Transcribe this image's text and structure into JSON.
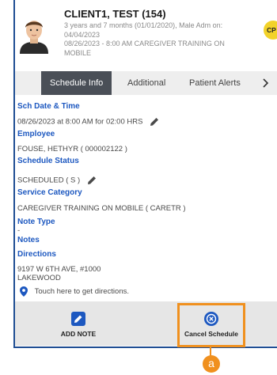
{
  "client": {
    "name": "CLIENT1, TEST (154)",
    "details_line1": "3 years and 7 months (01/01/2020), Male Adm on:",
    "details_line2": "04/04/2023",
    "details_line3": "08/26/2023 - 8:00 AM CAREGIVER TRAINING ON",
    "details_line4": "MOBILE",
    "badge": "CP"
  },
  "tabs": [
    {
      "label": "Schedule Info",
      "active": true
    },
    {
      "label": "Additional",
      "active": false
    },
    {
      "label": "Patient Alerts",
      "active": false
    }
  ],
  "tabs_more_icon": "chevron-right-icon",
  "fields": {
    "sch_date_label": "Sch Date & Time",
    "sch_date_value": "08/26/2023 at 8:00 AM for 02:00 HRS",
    "employee_label": "Employee",
    "employee_value": "FOUSE, HETHYR ( 000002122 )",
    "status_label": "Schedule Status",
    "status_value": "SCHEDULED ( S )",
    "service_label": "Service Category",
    "service_value": "CAREGIVER TRAINING ON MOBILE ( CARETR )",
    "note_type_label": "Note Type",
    "note_type_value": "-",
    "notes_label": "Notes",
    "directions_label": "Directions",
    "address_line1": "9197 W 6TH AVE, #1000",
    "address_line2": "LAKEWOOD",
    "directions_link": "Touch here to get directions."
  },
  "actions": {
    "add_note_label": "ADD NOTE",
    "cancel_schedule_label": "Cancel Schedule"
  },
  "annotation": {
    "marker_label": "a"
  },
  "colors": {
    "accent_blue": "#1d58c0",
    "tab_active_bg": "#4a4f57",
    "highlight_orange": "#f0901e",
    "badge_yellow": "#f2d22a"
  }
}
